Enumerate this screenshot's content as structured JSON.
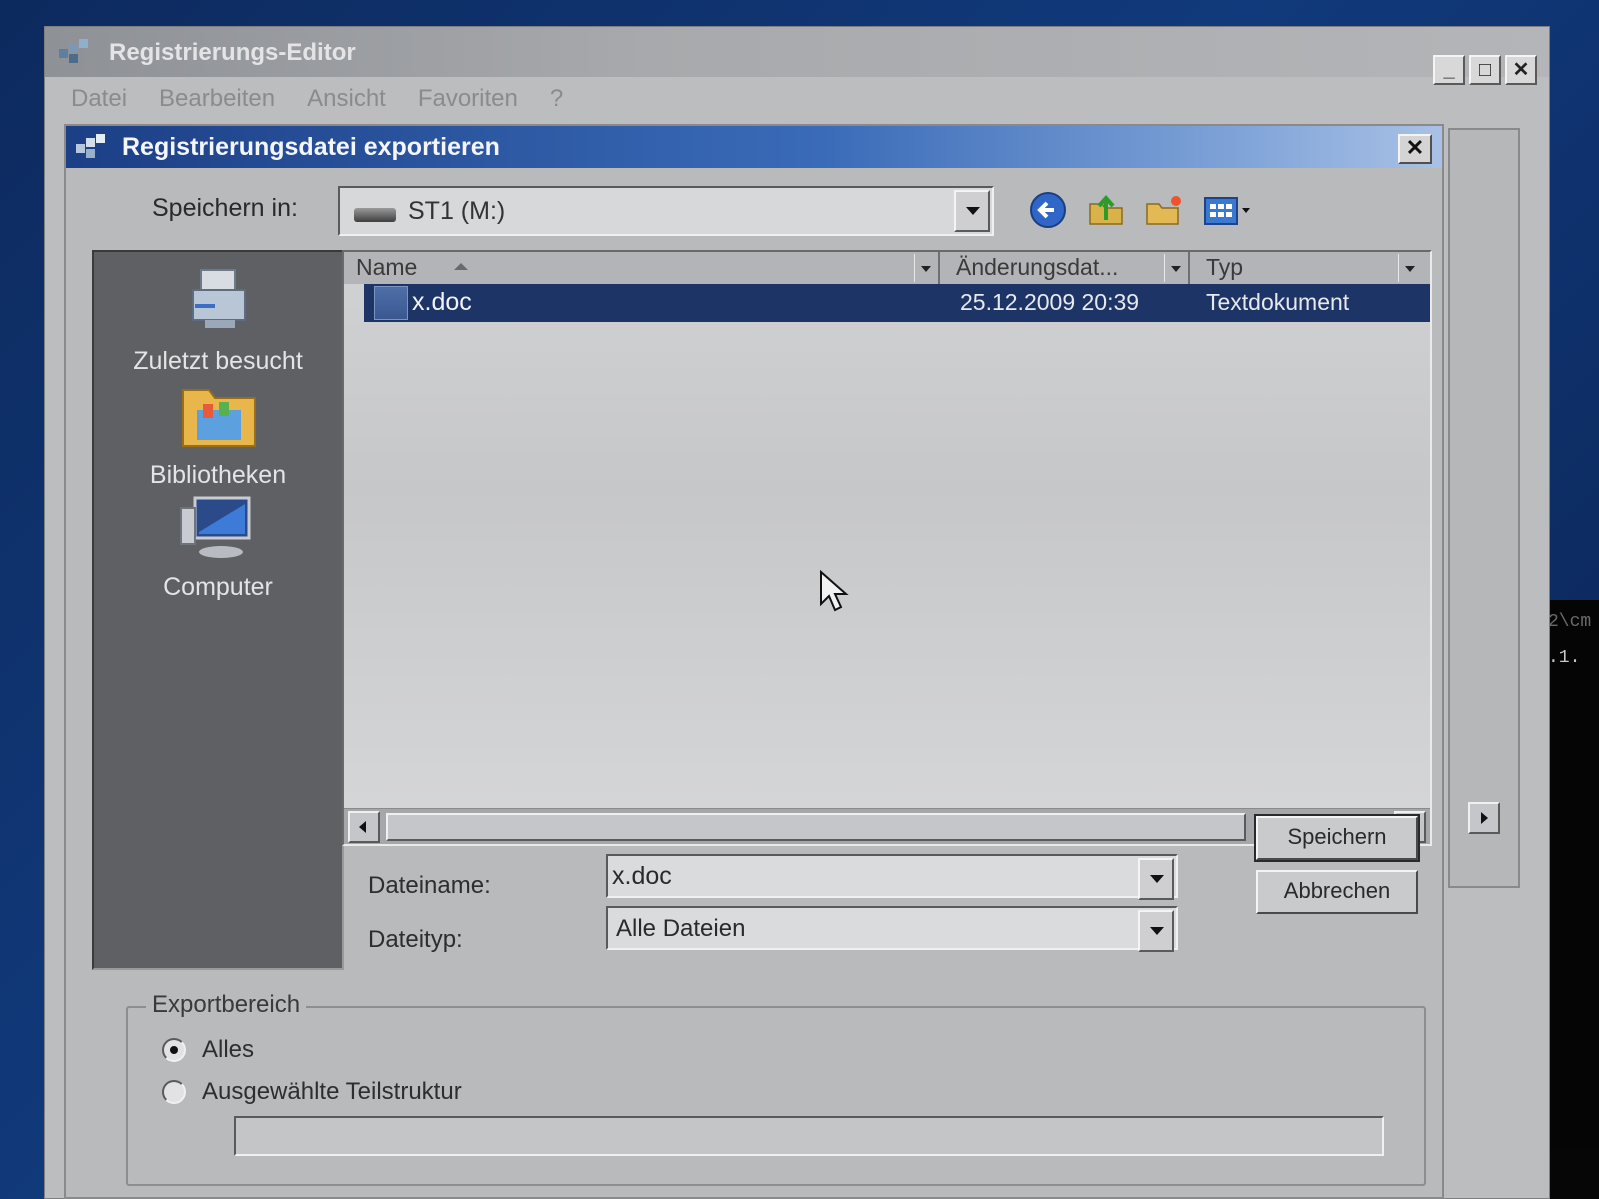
{
  "main_window": {
    "title": "Registrierungs-Editor",
    "controls": {
      "minimize": "_",
      "maximize": "□",
      "close": "✕"
    },
    "menu": [
      "Datei",
      "Bearbeiten",
      "Ansicht",
      "Favoriten",
      "?"
    ]
  },
  "dialog": {
    "title": "Registrierungsdatei exportieren",
    "close": "✕",
    "save_in": {
      "label": "Speichern in:",
      "value": "ST1 (M:)"
    },
    "toolbar": [
      "back-icon",
      "up-folder-icon",
      "new-folder-icon",
      "view-menu-icon"
    ],
    "places": [
      {
        "label": "Zuletzt besucht",
        "icon": "recent-places-icon"
      },
      {
        "label": "Bibliotheken",
        "icon": "libraries-icon"
      },
      {
        "label": "Computer",
        "icon": "computer-icon"
      }
    ],
    "columns": [
      "Name",
      "Änderungsdat...",
      "Typ"
    ],
    "files": [
      {
        "name": "x.doc",
        "date": "25.12.2009 20:39",
        "type": "Textdokument",
        "selected": true
      }
    ],
    "filename": {
      "label": "Dateiname:",
      "value": "x.doc"
    },
    "filetype": {
      "label": "Dateityp:",
      "value": "Alle Dateien"
    },
    "buttons": {
      "save": "Speichern",
      "cancel": "Abbrechen"
    },
    "export_range": {
      "label": "Exportbereich",
      "options": [
        {
          "label": "Alles",
          "checked": true
        },
        {
          "label": "Ausgewählte Teilstruktur",
          "checked": false
        }
      ],
      "subtree_value": ""
    }
  },
  "console": {
    "line1": "2\\cm",
    "line2": ".1."
  },
  "colors": {
    "dialog_title_start": "#1c3f86",
    "selection": "#1d3566",
    "places_bg": "#5f6063",
    "desktop": "#113a7c"
  }
}
